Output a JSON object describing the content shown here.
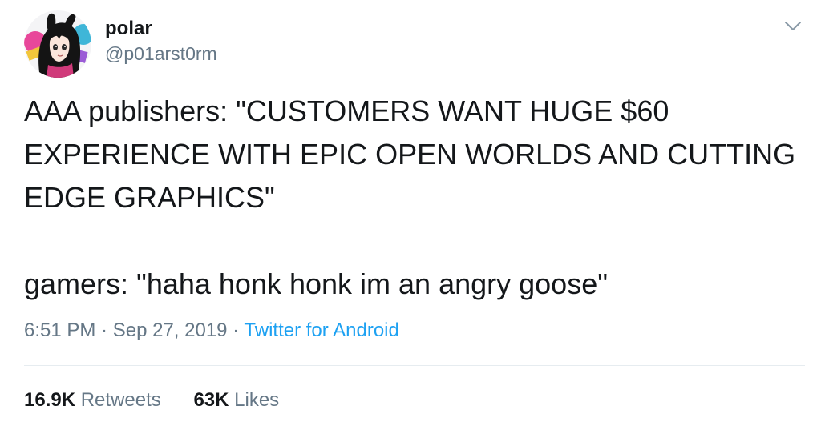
{
  "author": {
    "display_name": "polar",
    "handle": "@p01arst0rm",
    "avatar_icon": "anime-character-avatar"
  },
  "menu_icon": "chevron-down-icon",
  "tweet": {
    "text_paragraphs": [
      "AAA publishers: \"CUSTOMERS WANT HUGE $60 EXPERIENCE WITH EPIC OPEN WORLDS AND CUTTING EDGE GRAPHICS\"",
      "gamers: \"haha honk honk im an angry goose\""
    ]
  },
  "meta": {
    "time": "6:51 PM",
    "separator": " · ",
    "date": "Sep 27, 2019",
    "source": "Twitter for Android"
  },
  "stats": {
    "retweets_count": "16.9K",
    "retweets_label": "Retweets",
    "likes_count": "63K",
    "likes_label": "Likes"
  },
  "colors": {
    "text": "#14171a",
    "secondary": "#657786",
    "link": "#1da1f2",
    "divider": "#e6ecf0"
  }
}
